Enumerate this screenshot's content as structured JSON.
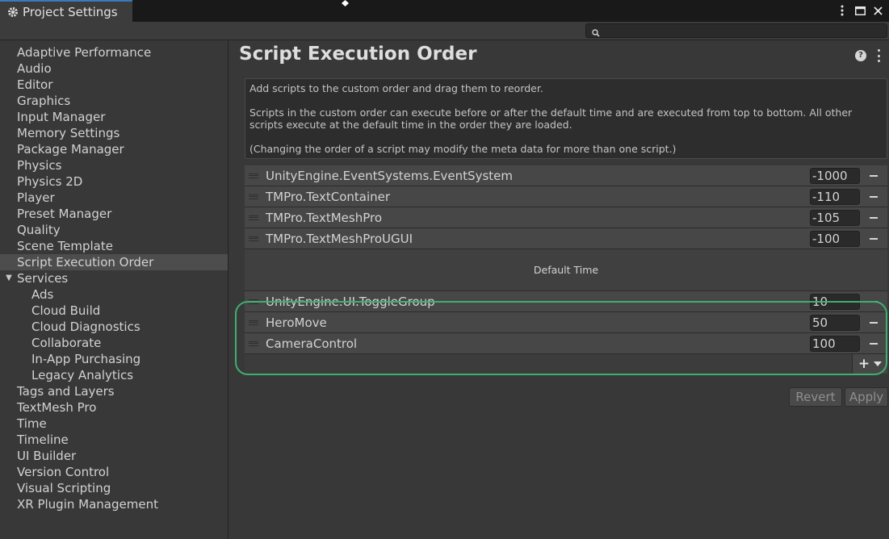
{
  "window": {
    "tab_title": "Project Settings"
  },
  "search": {
    "placeholder": ""
  },
  "sidebar": {
    "items": [
      {
        "label": "Adaptive Performance"
      },
      {
        "label": "Audio"
      },
      {
        "label": "Editor"
      },
      {
        "label": "Graphics"
      },
      {
        "label": "Input Manager"
      },
      {
        "label": "Memory Settings"
      },
      {
        "label": "Package Manager"
      },
      {
        "label": "Physics"
      },
      {
        "label": "Physics 2D"
      },
      {
        "label": "Player"
      },
      {
        "label": "Preset Manager"
      },
      {
        "label": "Quality"
      },
      {
        "label": "Scene Template"
      },
      {
        "label": "Script Execution Order",
        "selected": true
      },
      {
        "label": "Services",
        "expanded": true
      },
      {
        "label": "Ads",
        "child": true
      },
      {
        "label": "Cloud Build",
        "child": true
      },
      {
        "label": "Cloud Diagnostics",
        "child": true
      },
      {
        "label": "Collaborate",
        "child": true
      },
      {
        "label": "In-App Purchasing",
        "child": true
      },
      {
        "label": "Legacy Analytics",
        "child": true
      },
      {
        "label": "Tags and Layers"
      },
      {
        "label": "TextMesh Pro"
      },
      {
        "label": "Time"
      },
      {
        "label": "Timeline"
      },
      {
        "label": "UI Builder"
      },
      {
        "label": "Version Control"
      },
      {
        "label": "Visual Scripting"
      },
      {
        "label": "XR Plugin Management"
      }
    ]
  },
  "main": {
    "title": "Script Execution Order",
    "help_text": {
      "line1": "Add scripts to the custom order and drag them to reorder.",
      "line2": "Scripts in the custom order can execute before or after the default time and are executed from top to bottom. All other scripts execute at the default time in the order they are loaded.",
      "line3": "(Changing the order of a script may modify the meta data for more than one script.)"
    },
    "scripts_before": [
      {
        "name": "UnityEngine.EventSystems.EventSystem",
        "order": "-1000"
      },
      {
        "name": "TMPro.TextContainer",
        "order": "-110"
      },
      {
        "name": "TMPro.TextMeshPro",
        "order": "-105"
      },
      {
        "name": "TMPro.TextMeshProUGUI",
        "order": "-100"
      }
    ],
    "default_time_label": "Default Time",
    "scripts_after": [
      {
        "name": "UnityEngine.UI.ToggleGroup",
        "order": "10"
      },
      {
        "name": "HeroMove",
        "order": "50"
      },
      {
        "name": "CameraControl",
        "order": "100"
      }
    ],
    "revert_label": "Revert",
    "apply_label": "Apply"
  },
  "colors": {
    "accent_tab": "#3a79bb",
    "highlight": "#3fae72",
    "panel_bg": "#383838"
  }
}
